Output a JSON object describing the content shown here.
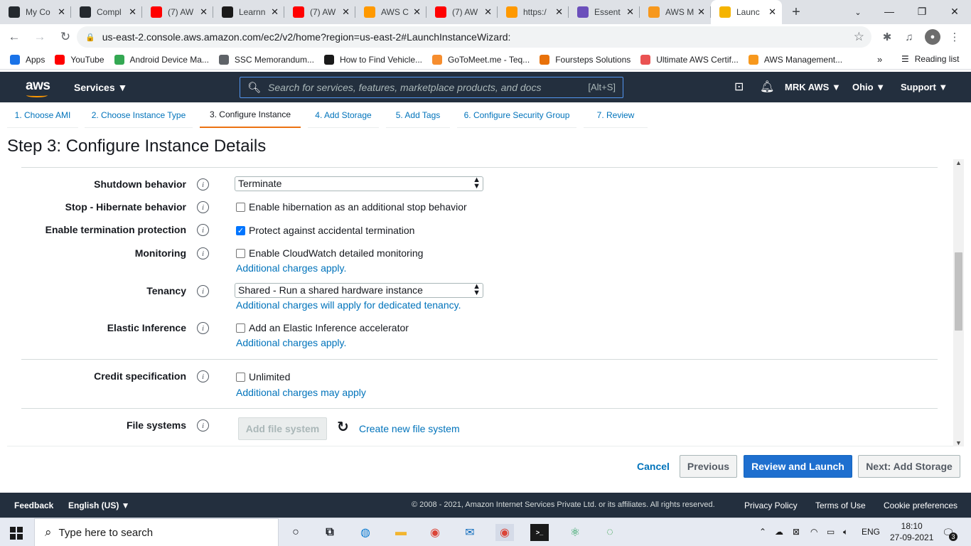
{
  "browser": {
    "tabs": [
      {
        "title": "My Co",
        "icon": "github-icon",
        "color": "#24292e"
      },
      {
        "title": "Compl",
        "icon": "github-icon",
        "color": "#24292e"
      },
      {
        "title": "(7) AW",
        "icon": "youtube-icon",
        "color": "#ff0000"
      },
      {
        "title": "Learnn",
        "icon": "learnn-icon",
        "color": "#1a1a1a"
      },
      {
        "title": "(7) AW",
        "icon": "youtube-icon",
        "color": "#ff0000"
      },
      {
        "title": "AWS C",
        "icon": "aws-cert-icon",
        "color": "#ff9900"
      },
      {
        "title": "(7) AW",
        "icon": "youtube-icon",
        "color": "#ff0000"
      },
      {
        "title": "https:/",
        "icon": "aws-cert-icon",
        "color": "#ff9900"
      },
      {
        "title": "Essent",
        "icon": "notion-icon",
        "color": "#6b4fbb"
      },
      {
        "title": "AWS M",
        "icon": "aws-box-icon",
        "color": "#f7981d"
      },
      {
        "title": "Launc",
        "icon": "aws-box-icon",
        "color": "#f5b400",
        "active": true
      }
    ],
    "new_tab": "+",
    "url": "us-east-2.console.aws.amazon.com/ec2/v2/home?region=us-east-2#LaunchInstanceWizard:",
    "bookmarks": [
      {
        "label": "Apps",
        "icon": "apps-grid-icon",
        "color": "#1a73e8"
      },
      {
        "label": "YouTube",
        "icon": "youtube-icon",
        "color": "#ff0000"
      },
      {
        "label": "Android Device Ma...",
        "icon": "google-icon",
        "color": "#34a853"
      },
      {
        "label": "SSC Memorandum...",
        "icon": "globe-icon",
        "color": "#5f6368"
      },
      {
        "label": "How to Find Vehicle...",
        "icon": "play-icon",
        "color": "#1a1a1a"
      },
      {
        "label": "GoToMeet.me - Teq...",
        "icon": "gotomeet-icon",
        "color": "#f68d2e"
      },
      {
        "label": "Foursteps Solutions",
        "icon": "bars-icon",
        "color": "#e8710a"
      },
      {
        "label": "Ultimate AWS Certif...",
        "icon": "udemy-icon",
        "color": "#ea5252"
      },
      {
        "label": "AWS Management...",
        "icon": "aws-box-icon",
        "color": "#f7981d"
      }
    ],
    "bookmarks_more": "»",
    "reading_list": "Reading list"
  },
  "aws_header": {
    "logo": "aws",
    "services": "Services ▼",
    "search_placeholder": "Search for services, features, marketplace products, and docs",
    "search_shortcut": "[Alt+S]",
    "account": "MRK AWS ▼",
    "region": "Ohio ▼",
    "support": "Support ▼"
  },
  "wizard_steps": [
    {
      "label": "1. Choose AMI"
    },
    {
      "label": "2. Choose Instance Type"
    },
    {
      "label": "3. Configure Instance",
      "active": true
    },
    {
      "label": "4. Add Storage"
    },
    {
      "label": "5. Add Tags"
    },
    {
      "label": "6. Configure Security Group"
    },
    {
      "label": "7. Review"
    }
  ],
  "page_title": "Step 3: Configure Instance Details",
  "form": {
    "shutdown_behavior": {
      "label": "Shutdown behavior",
      "value": "Terminate"
    },
    "stop_hibernate": {
      "label": "Stop - Hibernate behavior",
      "option": "Enable hibernation as an additional stop behavior",
      "checked": false
    },
    "termination_protection": {
      "label": "Enable termination protection",
      "option": "Protect against accidental termination",
      "checked": true
    },
    "monitoring": {
      "label": "Monitoring",
      "option": "Enable CloudWatch detailed monitoring",
      "checked": false,
      "note": "Additional charges apply."
    },
    "tenancy": {
      "label": "Tenancy",
      "value": "Shared - Run a shared hardware instance",
      "note": "Additional charges will apply for dedicated tenancy."
    },
    "elastic_inference": {
      "label": "Elastic Inference",
      "option": "Add an Elastic Inference accelerator",
      "checked": false,
      "note": "Additional charges apply."
    },
    "credit_specification": {
      "label": "Credit specification",
      "option": "Unlimited",
      "checked": false,
      "note": "Additional charges may apply"
    },
    "file_systems": {
      "label": "File systems",
      "add_button": "Add file system",
      "create_link": "Create new file system"
    }
  },
  "info_glyph": "i",
  "actions": {
    "cancel": "Cancel",
    "previous": "Previous",
    "review_launch": "Review and Launch",
    "next": "Next: Add Storage"
  },
  "footer": {
    "feedback": "Feedback",
    "language": "English (US) ▼",
    "copyright": "© 2008 - 2021, Amazon Internet Services Private Ltd. or its affiliates. All rights reserved.",
    "privacy": "Privacy Policy",
    "terms": "Terms of Use",
    "cookies": "Cookie preferences"
  },
  "taskbar": {
    "search_placeholder": "Type here to search",
    "lang": "ENG",
    "time": "18:10",
    "date": "27-09-2021",
    "notifications": "3"
  },
  "colors": {
    "aws_navy": "#232f3e",
    "aws_orange": "#ff9900",
    "link_blue": "#0073bb",
    "primary_button": "#1e6fcf",
    "active_step_underline": "#ec7211"
  }
}
